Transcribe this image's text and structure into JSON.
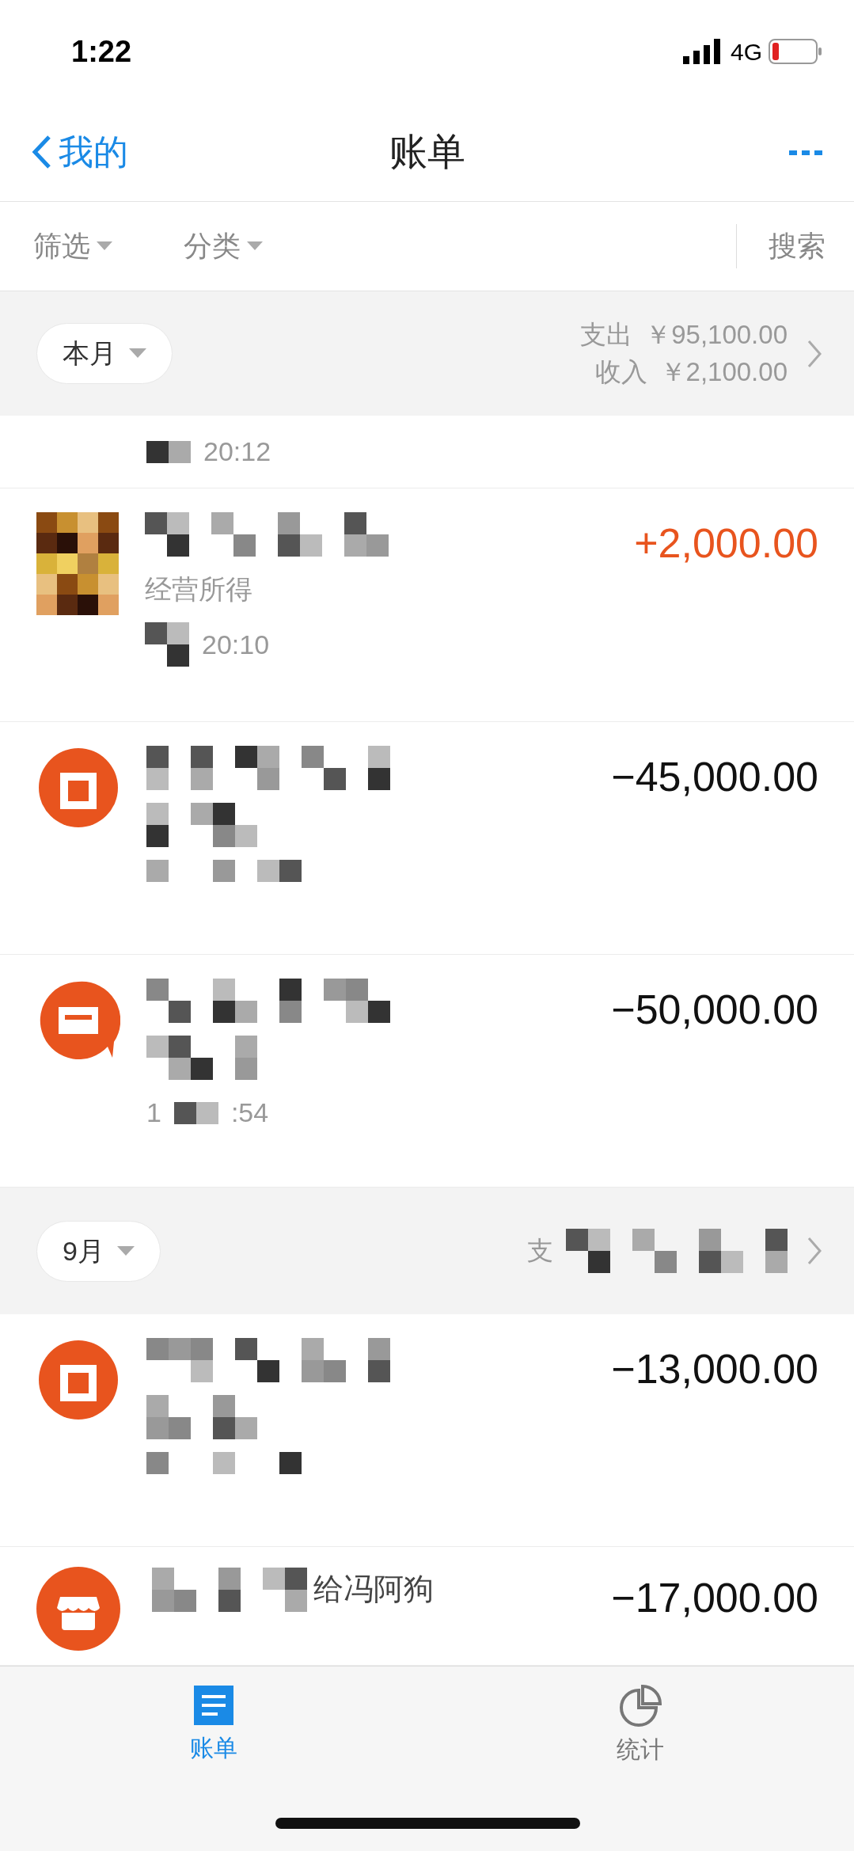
{
  "status_bar": {
    "time": "1:22",
    "network": "4G"
  },
  "nav": {
    "back": "我的",
    "title": "账单"
  },
  "filters": [
    {
      "label": "筛选"
    },
    {
      "label": "分类"
    }
  ],
  "search": "搜索",
  "sections": [
    {
      "month": "本月",
      "summary": [
        {
          "label": "支出",
          "value": "￥95,100.00"
        },
        {
          "label": "收入",
          "value": "￥2,100.00"
        }
      ],
      "rows": [
        {
          "kind": "partial",
          "time": "20:12"
        },
        {
          "kind": "avatar",
          "amount": "+2,000.00",
          "income": true,
          "category": "经营所得",
          "time": "20:10"
        },
        {
          "kind": "shop",
          "amount": "−45,000.00",
          "income": false
        },
        {
          "kind": "chat",
          "amount": "−50,000.00",
          "income": false,
          "time_parts": [
            "1",
            ":54"
          ]
        }
      ]
    },
    {
      "month": "9月",
      "summary": [
        {
          "label": "支"
        }
      ],
      "rows": [
        {
          "kind": "shop",
          "amount": "−13,000.00",
          "income": false
        },
        {
          "kind": "store",
          "amount": "−17,000.00",
          "income": false,
          "name_tail": "给冯阿狗"
        }
      ]
    }
  ],
  "tabs": [
    {
      "label": "账单",
      "kind": "list",
      "selected": true
    },
    {
      "label": "统计",
      "kind": "pie",
      "selected": false
    }
  ]
}
